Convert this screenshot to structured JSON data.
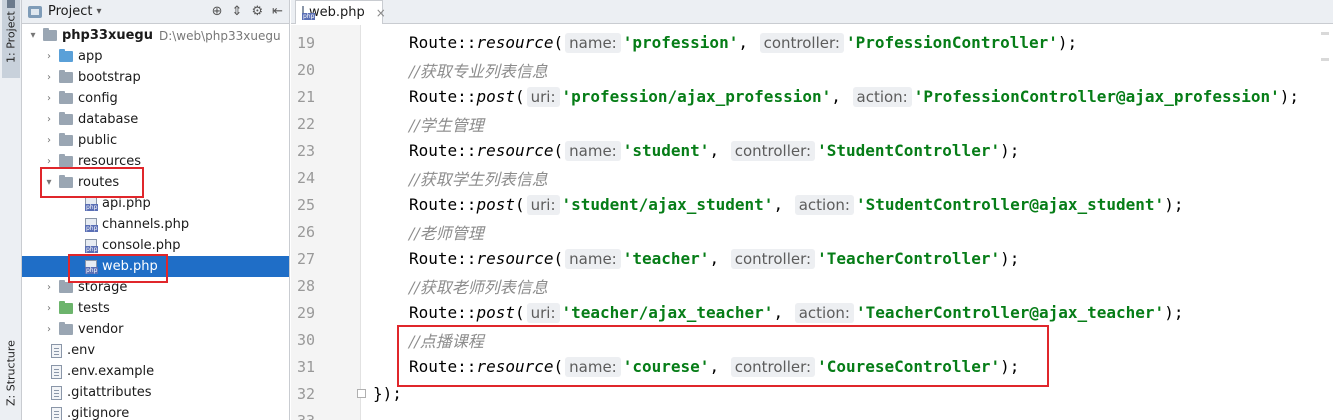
{
  "toolstrip": {
    "project_tab": "1: Project",
    "structure_tab": "Z: Structure"
  },
  "project_pane": {
    "title": "Project",
    "tree": [
      {
        "kind": "root",
        "name": "php33xuegu",
        "path": "D:\\web\\php33xuegu",
        "arrow": "▾"
      },
      {
        "kind": "folder-blue",
        "name": "app",
        "arrow": "›"
      },
      {
        "kind": "folder",
        "name": "bootstrap",
        "arrow": "›"
      },
      {
        "kind": "folder",
        "name": "config",
        "arrow": "›"
      },
      {
        "kind": "folder",
        "name": "database",
        "arrow": "›"
      },
      {
        "kind": "folder",
        "name": "public",
        "arrow": "›"
      },
      {
        "kind": "folder",
        "name": "resources",
        "arrow": "›"
      },
      {
        "kind": "folder",
        "name": "routes",
        "arrow": "▾"
      },
      {
        "kind": "php",
        "name": "api.php"
      },
      {
        "kind": "php",
        "name": "channels.php"
      },
      {
        "kind": "php",
        "name": "console.php"
      },
      {
        "kind": "php",
        "name": "web.php",
        "selected": true
      },
      {
        "kind": "folder",
        "name": "storage",
        "arrow": "›"
      },
      {
        "kind": "folder-green",
        "name": "tests",
        "arrow": "›"
      },
      {
        "kind": "folder",
        "name": "vendor",
        "arrow": "›"
      },
      {
        "kind": "file",
        "name": ".env"
      },
      {
        "kind": "file",
        "name": ".env.example"
      },
      {
        "kind": "file",
        "name": ".gitattributes"
      },
      {
        "kind": "file",
        "name": ".gitignore"
      }
    ]
  },
  "editor": {
    "tab_label": "web.php",
    "lines": [
      {
        "num": "19",
        "type": "call",
        "prefix": "Route::",
        "method": "resource",
        "hint1": "name:",
        "arg1": "'profession'",
        "hint2": "controller:",
        "arg2": "'ProfessionController'",
        "suffix": ");"
      },
      {
        "num": "20",
        "type": "comment",
        "text": "//获取专业列表信息"
      },
      {
        "num": "21",
        "type": "call",
        "prefix": "Route::",
        "method": "post",
        "hint1": "uri:",
        "arg1": "'profession/ajax_profession'",
        "hint2": "action:",
        "arg2": "'ProfessionController@ajax_profession'",
        "suffix": ");"
      },
      {
        "num": "22",
        "type": "comment",
        "text": "//学生管理"
      },
      {
        "num": "23",
        "type": "call",
        "prefix": "Route::",
        "method": "resource",
        "hint1": "name:",
        "arg1": "'student'",
        "hint2": "controller:",
        "arg2": "'StudentController'",
        "suffix": ");"
      },
      {
        "num": "24",
        "type": "comment",
        "text": "//获取学生列表信息"
      },
      {
        "num": "25",
        "type": "call",
        "prefix": "Route::",
        "method": "post",
        "hint1": "uri:",
        "arg1": "'student/ajax_student'",
        "hint2": "action:",
        "arg2": "'StudentController@ajax_student'",
        "suffix": ");"
      },
      {
        "num": "26",
        "type": "comment",
        "text": "//老师管理"
      },
      {
        "num": "27",
        "type": "call",
        "prefix": "Route::",
        "method": "resource",
        "hint1": "name:",
        "arg1": "'teacher'",
        "hint2": "controller:",
        "arg2": "'TeacherController'",
        "suffix": ");"
      },
      {
        "num": "28",
        "type": "comment",
        "text": "//获取老师列表信息"
      },
      {
        "num": "29",
        "type": "call",
        "prefix": "Route::",
        "method": "post",
        "hint1": "uri:",
        "arg1": "'teacher/ajax_teacher'",
        "hint2": "action:",
        "arg2": "'TeacherController@ajax_teacher'",
        "suffix": ");"
      },
      {
        "num": "30",
        "type": "comment",
        "text": "//点播课程"
      },
      {
        "num": "31",
        "type": "call",
        "prefix": "Route::",
        "method": "resource",
        "hint1": "name:",
        "arg1": "'courese'",
        "hint2": "controller:",
        "arg2": "'CoureseController'",
        "suffix": ");"
      },
      {
        "num": "32",
        "type": "close",
        "text": "});"
      },
      {
        "num": "33",
        "type": "empty",
        "text": ""
      }
    ]
  }
}
